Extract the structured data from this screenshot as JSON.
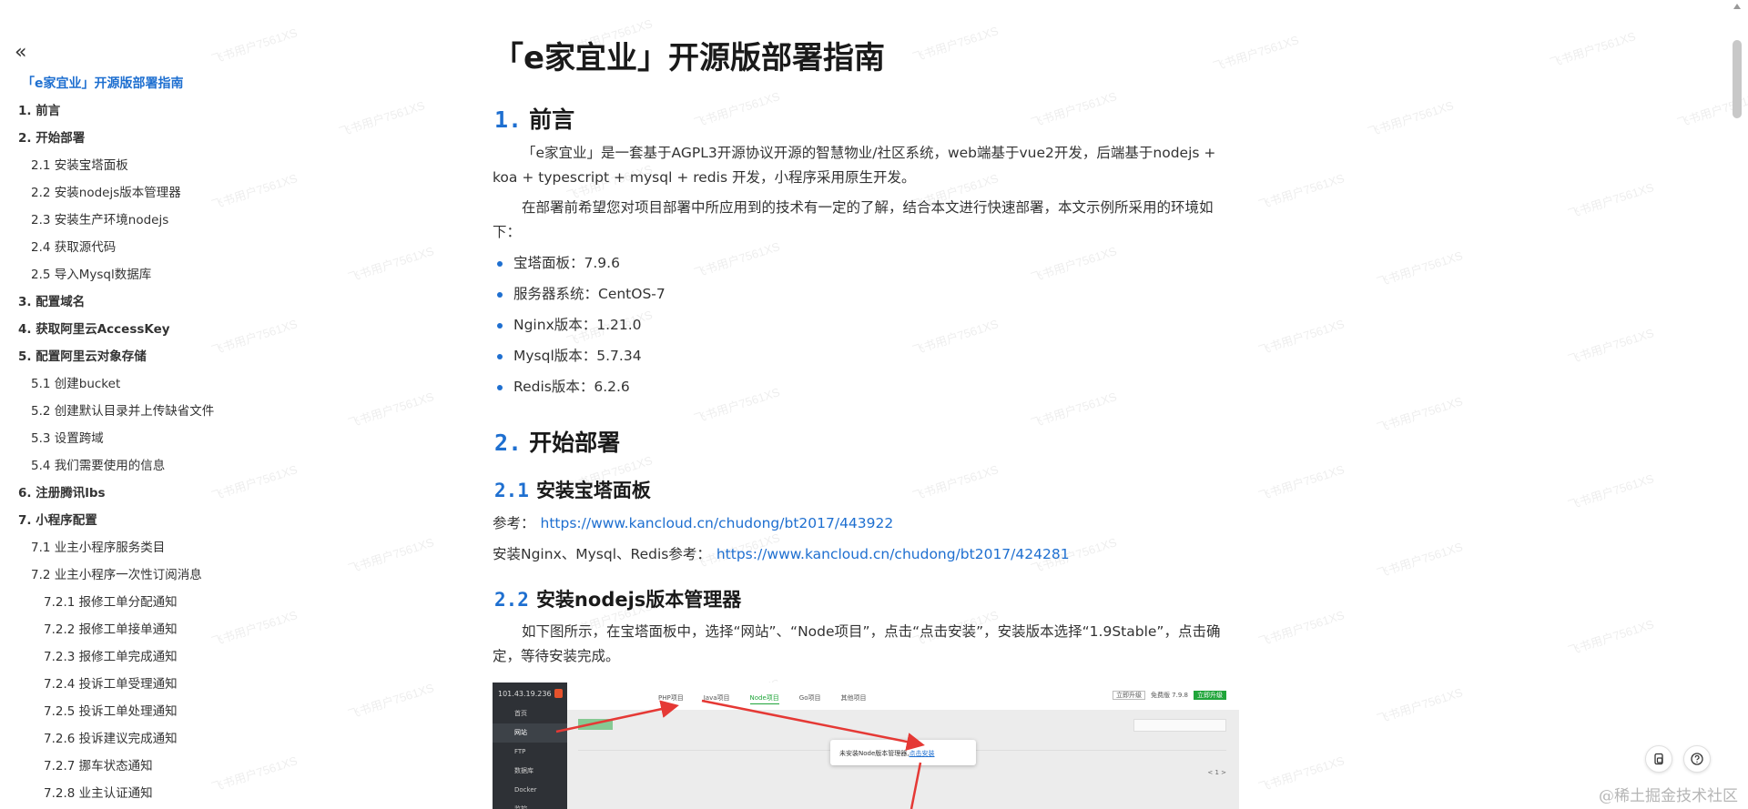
{
  "sidebar": {
    "items": [
      {
        "level": 0,
        "label": "「e家宜业」开源版部署指南"
      },
      {
        "level": 1,
        "label": "1. 前言"
      },
      {
        "level": 1,
        "label": "2. 开始部署"
      },
      {
        "level": 2,
        "label": "2.1 安装宝塔面板"
      },
      {
        "level": 2,
        "label": "2.2 安装nodejs版本管理器"
      },
      {
        "level": 2,
        "label": "2.3 安装生产环境nodejs"
      },
      {
        "level": 2,
        "label": "2.4 获取源代码"
      },
      {
        "level": 2,
        "label": "2.5 导入Mysql数据库"
      },
      {
        "level": 1,
        "label": "3. 配置域名"
      },
      {
        "level": 1,
        "label": "4. 获取阿里云AccessKey"
      },
      {
        "level": 1,
        "label": "5. 配置阿里云对象存储"
      },
      {
        "level": 2,
        "label": "5.1 创建bucket"
      },
      {
        "level": 2,
        "label": "5.2 创建默认目录并上传缺省文件"
      },
      {
        "level": 2,
        "label": "5.3 设置跨域"
      },
      {
        "level": 2,
        "label": "5.4 我们需要使用的信息"
      },
      {
        "level": 1,
        "label": "6. 注册腾讯lbs"
      },
      {
        "level": 1,
        "label": "7. 小程序配置"
      },
      {
        "level": 2,
        "label": "7.1 业主小程序服务类目"
      },
      {
        "level": 2,
        "label": "7.2 业主小程序一次性订阅消息"
      },
      {
        "level": 3,
        "label": "7.2.1 报修工单分配通知"
      },
      {
        "level": 3,
        "label": "7.2.2 报修工单接单通知"
      },
      {
        "level": 3,
        "label": "7.2.3 报修工单完成通知"
      },
      {
        "level": 3,
        "label": "7.2.4 投诉工单受理通知"
      },
      {
        "level": 3,
        "label": "7.2.5 投诉工单处理通知"
      },
      {
        "level": 3,
        "label": "7.2.6 投诉建议完成通知"
      },
      {
        "level": 3,
        "label": "7.2.7 挪车状态通知"
      },
      {
        "level": 3,
        "label": "7.2.8 业主认证通知"
      }
    ]
  },
  "article": {
    "title": "「e家宜业」开源版部署指南",
    "s1": {
      "num": "1.",
      "title": "前言",
      "p1": "「e家宜业」是一套基于AGPL3开源协议开源的智慧物业/社区系统，web端基于vue2开发，后端基于nodejs + koa + typescript + mysql + redis 开发，小程序采用原生开发。",
      "p2": "在部署前希望您对项目部署中所应用到的技术有一定的了解，结合本文进行快速部署，本文示例所采用的环境如下：",
      "bullets": [
        "宝塔面板：7.9.6",
        "服务器系统：CentOS-7",
        "Nginx版本：1.21.0",
        "Mysql版本：5.7.34",
        "Redis版本：6.2.6"
      ]
    },
    "s2": {
      "num": "2.",
      "title": "开始部署"
    },
    "s21": {
      "num": "2.1",
      "title": "安装宝塔面板",
      "ref1_label": "参考：",
      "ref1_link": "https://www.kancloud.cn/chudong/bt2017/443922",
      "ref2_label": "安装Nginx、Mysql、Redis参考：",
      "ref2_link": "https://www.kancloud.cn/chudong/bt2017/424281"
    },
    "s22": {
      "num": "2.2",
      "title": "安装nodejs版本管理器",
      "p1": "如下图所示，在宝塔面板中，选择“网站”、“Node项目”，点击“点击安装”，安装版本选择“1.9Stable”，点击确定，等待安装完成。"
    }
  },
  "screenshot": {
    "ip": "101.43.19.236",
    "menu": [
      "首页",
      "网站",
      "FTP",
      "数据库",
      "Docker",
      "监控"
    ],
    "active_menu": 1,
    "tabs": [
      "PHP项目",
      "Java项目",
      "Node项目",
      "Go项目",
      "其他项目"
    ],
    "active_tab": 2,
    "right_grey": "立即升级",
    "right_text": "免费版 7.9.8",
    "right_green": "立即升级",
    "dialog_text": "未安装Node版本管理器,",
    "dialog_link": "点击安装",
    "arrow_color": "#e53935"
  },
  "watermark": "飞书用户7561XS",
  "footer_mark": "@稀土掘金技术社区",
  "colors": {
    "accent": "#1e6fd0",
    "panel_green": "#20a53a"
  }
}
